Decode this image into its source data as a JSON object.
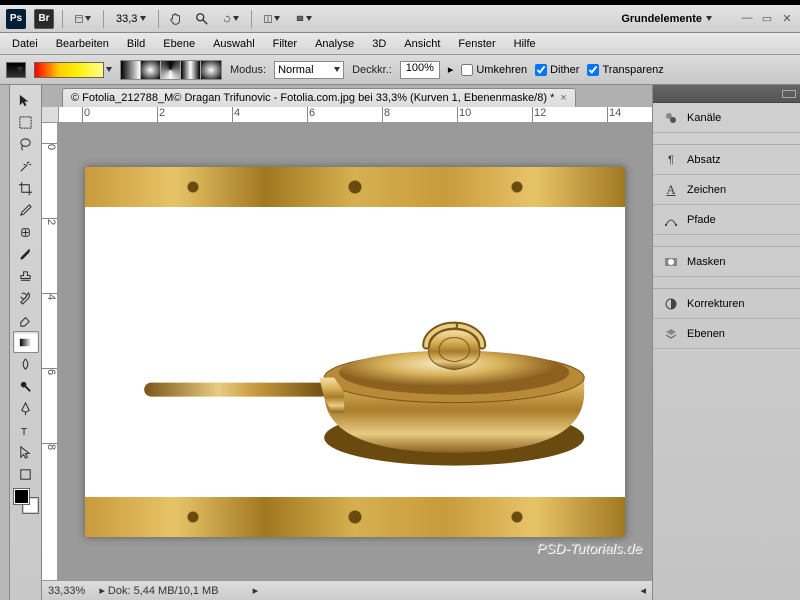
{
  "topbar": {
    "zoom": "33,3",
    "workspace": "Grundelemente"
  },
  "menu": [
    "Datei",
    "Bearbeiten",
    "Bild",
    "Ebene",
    "Auswahl",
    "Filter",
    "Analyse",
    "3D",
    "Ansicht",
    "Fenster",
    "Hilfe"
  ],
  "options": {
    "mode_label": "Modus:",
    "mode_value": "Normal",
    "opacity_label": "Deckkr.:",
    "opacity_value": "100%",
    "reverse": "Umkehren",
    "dither": "Dither",
    "transparency": "Transparenz"
  },
  "document": {
    "tab_title": "© Fotolia_212788_M© Dragan Trifunovic - Fotolia.com.jpg bei 33,3% (Kurven 1, Ebenenmaske/8) *",
    "ruler_marks": [
      "0",
      "2",
      "4",
      "6",
      "8",
      "10",
      "12",
      "14"
    ],
    "ruler_v_marks": [
      "0",
      "2",
      "4",
      "6",
      "8"
    ]
  },
  "status": {
    "zoom": "33,33%",
    "doc_info": "Dok: 5,44 MB/10,1 MB"
  },
  "panels": [
    "Kanäle",
    "Absatz",
    "Zeichen",
    "Pfade",
    "Masken",
    "Korrekturen",
    "Ebenen"
  ],
  "branding": "PSD-Tutorials.de"
}
